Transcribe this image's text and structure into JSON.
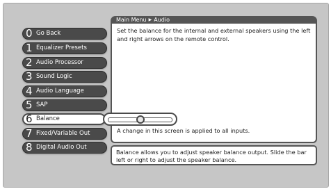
{
  "breadcrumb": {
    "root": "Main Menu",
    "separator": "▶",
    "current": "Audio"
  },
  "description": "Set the balance for the internal and external speakers using the left and right arrows on the remote control.",
  "note": "A change in this screen is applied to all inputs.",
  "help": "Balance allows you to adjust speaker balance output. Slide the bar left or right to adjust the speaker balance.",
  "menu": [
    {
      "num": "0",
      "label": "Go Back"
    },
    {
      "num": "1",
      "label": "Equalizer Presets"
    },
    {
      "num": "2",
      "label": "Audio Processor"
    },
    {
      "num": "3",
      "label": "Sound Logic"
    },
    {
      "num": "4",
      "label": "Audio Language"
    },
    {
      "num": "5",
      "label": "SAP"
    },
    {
      "num": "6",
      "label": "Balance"
    },
    {
      "num": "7",
      "label": "Fixed/Variable Out"
    },
    {
      "num": "8",
      "label": "Digital Audio Out"
    }
  ],
  "balance": {
    "value": 0.5
  }
}
